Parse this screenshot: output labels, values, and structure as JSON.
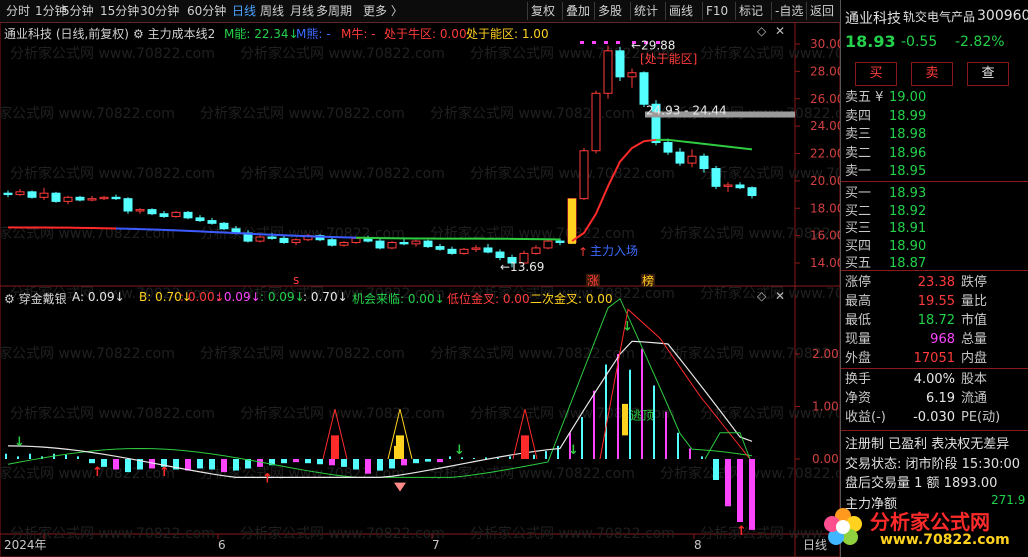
{
  "toolbar": {
    "items": [
      "分时",
      "1分钟",
      "5分钟",
      "15分钟",
      "30分钟",
      "60分钟",
      "日线",
      "周线",
      "月线",
      "多周期",
      "更多 〉"
    ],
    "active_index": 6,
    "right_items": [
      "复权",
      "叠加",
      "多股",
      "统计",
      "画线",
      "F10",
      "标记",
      "-自选",
      "返回"
    ]
  },
  "main_chart": {
    "header": {
      "stock": "通业科技 (日线,前复权)",
      "indicator": "主力成本线2",
      "m_energy": "M能: 22.34↓",
      "m_bear": "M熊: -",
      "m_bull": "M牛: -",
      "in_bull_zone": "处于牛区: 0.00",
      "in_energy_zone": "处于能区: 1.00"
    },
    "y_ticks": [
      "30.00",
      "28.00",
      "26.00",
      "24.00",
      "22.00",
      "20.00",
      "18.00",
      "16.00",
      "14.00"
    ],
    "annotations": {
      "high": "29.88",
      "zone": "[处于能区]",
      "range": "24.93 - 24.44",
      "low": "13.69",
      "entry": "主力入场",
      "tag_zhang": "涨",
      "tag_bang": "榜",
      "tag_s": "s"
    }
  },
  "sub_chart": {
    "header": {
      "name": "穿金戴银",
      "a": "A: 0.09↓",
      "b": "B: 0.70↓",
      "v1": ": 0.00↓",
      "v2": ": 0.09↓",
      "v3": ": 0.09↓",
      "v4": ": 0.70↓",
      "chance": "机会来临: 0.00↓",
      "low_cross": "低位金叉: 0.00",
      "second_cross": "二次金叉: 0.00"
    },
    "y_ticks": [
      "2.00",
      "1.00",
      "0.00"
    ],
    "annotation_escape": "逃顶"
  },
  "x_axis": {
    "labels": [
      "2024年",
      "6",
      "7",
      "8"
    ],
    "right_label": "日线"
  },
  "panel": {
    "name": "通业科技",
    "sector": "轨交电气产品",
    "code": "300960",
    "price": "18.93",
    "change": "-0.55",
    "change_pct": "-2.82%",
    "buttons": [
      "买",
      "卖",
      "查"
    ],
    "asks": [
      {
        "label": "卖五 ¥",
        "price": "19.00"
      },
      {
        "label": "卖四",
        "price": "18.99"
      },
      {
        "label": "卖三",
        "price": "18.98"
      },
      {
        "label": "卖二",
        "price": "18.96"
      },
      {
        "label": "卖一",
        "price": "18.95"
      }
    ],
    "bids": [
      {
        "label": "买一",
        "price": "18.93"
      },
      {
        "label": "买二",
        "price": "18.92"
      },
      {
        "label": "买三",
        "price": "18.91"
      },
      {
        "label": "买四",
        "price": "18.90"
      },
      {
        "label": "买五",
        "price": "18.87"
      }
    ],
    "stats": [
      {
        "l": "涨停",
        "v": "23.38",
        "r": "跌停"
      },
      {
        "l": "最高",
        "v": "19.55",
        "r": "量比"
      },
      {
        "l": "最低",
        "v": "18.72",
        "r": "市值"
      },
      {
        "l": "现量",
        "v": "968",
        "r": "总量"
      },
      {
        "l": "外盘",
        "v": "17051",
        "r": "内盘"
      }
    ],
    "stats2": [
      {
        "l": "换手",
        "v": "4.00%",
        "r": "股本"
      },
      {
        "l": "净资",
        "v": "6.19",
        "r": "流通"
      },
      {
        "l": "收益(-)",
        "v": "-0.030",
        "r": "PE(动)"
      }
    ],
    "tags": "注册制 已盈利 表决权无差异",
    "trade_status": "交易状态: 闭市阶段 15:30:00",
    "after_hours": "盘后交易量 1 额 1893.00",
    "net_inflow_label": "主力净额",
    "net_inflow_value": "271.9"
  },
  "watermark_text": "分析家公式网 www.70822.com",
  "logo": {
    "title": "分析家公式网",
    "url": "www.70822.com"
  }
}
